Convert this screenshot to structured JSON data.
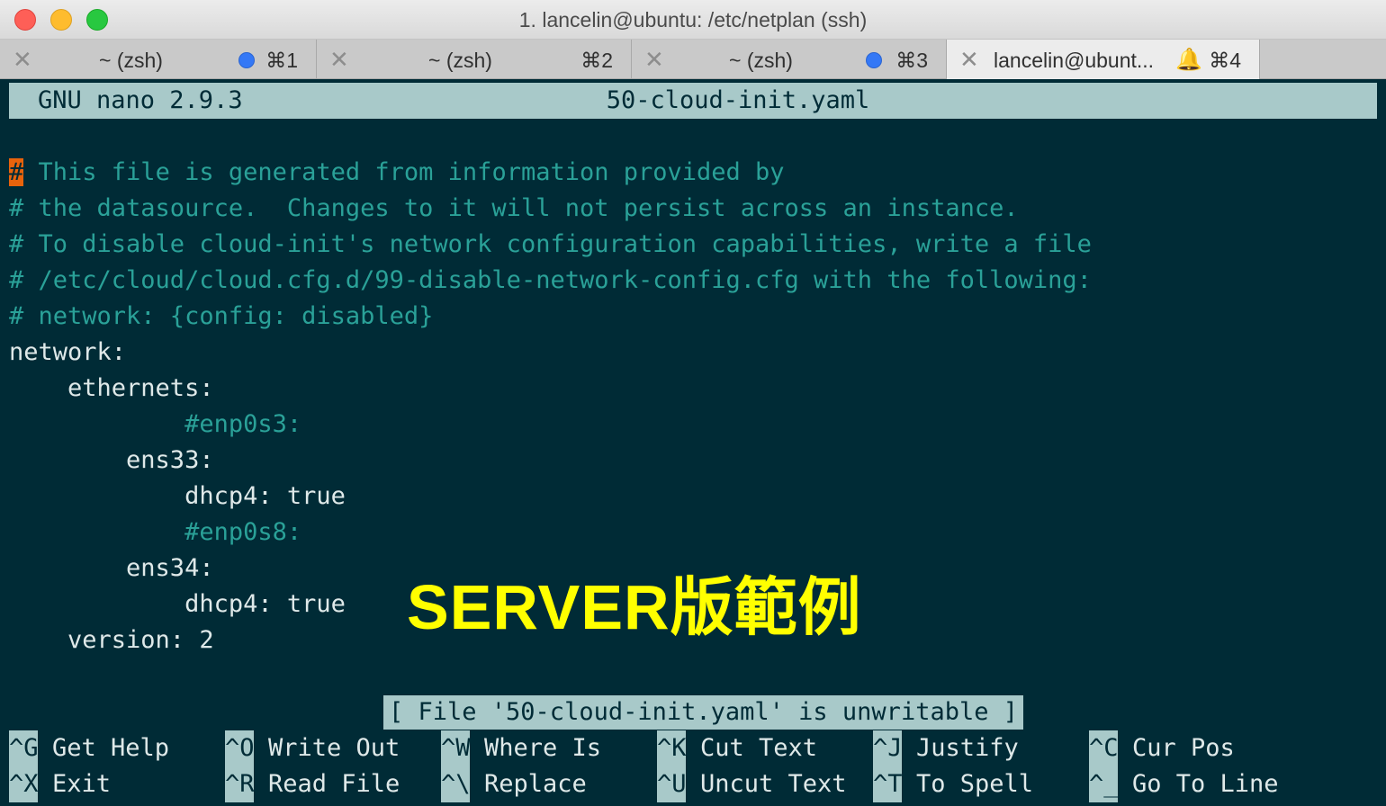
{
  "window": {
    "title": "1. lancelin@ubuntu: /etc/netplan (ssh)"
  },
  "tabs": [
    {
      "label": "~ (zsh)",
      "shortcut": "⌘1",
      "dot": true
    },
    {
      "label": "~ (zsh)",
      "shortcut": "⌘2",
      "dot": false
    },
    {
      "label": "~ (zsh)",
      "shortcut": "⌘3",
      "dot": true
    },
    {
      "label": "lancelin@ubunt...",
      "shortcut": "⌘4",
      "bell": true,
      "active": true
    }
  ],
  "nano": {
    "version": "GNU nano 2.9.3",
    "filename": "50-cloud-init.yaml",
    "lines": [
      {
        "text": "# This file is generated from information provided by",
        "type": "comment"
      },
      {
        "text": "# the datasource.  Changes to it will not persist across an instance.",
        "type": "comment"
      },
      {
        "text": "# To disable cloud-init's network configuration capabilities, write a file",
        "type": "comment"
      },
      {
        "text": "# /etc/cloud/cloud.cfg.d/99-disable-network-config.cfg with the following:",
        "type": "comment"
      },
      {
        "text": "# network: {config: disabled}",
        "type": "comment"
      },
      {
        "text": "network:",
        "type": "plain"
      },
      {
        "text": "    ethernets:",
        "type": "plain"
      },
      {
        "text": "            #enp0s3:",
        "type": "comment"
      },
      {
        "text": "        ens33:",
        "type": "plain"
      },
      {
        "text": "            dhcp4: true",
        "type": "plain"
      },
      {
        "text": "            #enp0s8:",
        "type": "comment"
      },
      {
        "text": "        ens34:",
        "type": "plain"
      },
      {
        "text": "            dhcp4: true",
        "type": "plain"
      },
      {
        "text": "    version: 2",
        "type": "plain"
      }
    ],
    "status": "[ File '50-cloud-init.yaml' is unwritable ]",
    "shortcuts": [
      [
        {
          "key": "^G",
          "label": "Get Help"
        },
        {
          "key": "^O",
          "label": "Write Out"
        },
        {
          "key": "^W",
          "label": "Where Is"
        },
        {
          "key": "^K",
          "label": "Cut Text"
        },
        {
          "key": "^J",
          "label": "Justify"
        },
        {
          "key": "^C",
          "label": "Cur Pos"
        }
      ],
      [
        {
          "key": "^X",
          "label": "Exit"
        },
        {
          "key": "^R",
          "label": "Read File"
        },
        {
          "key": "^\\",
          "label": "Replace"
        },
        {
          "key": "^U",
          "label": "Uncut Text"
        },
        {
          "key": "^T",
          "label": "To Spell"
        },
        {
          "key": "^_",
          "label": "Go To Line"
        }
      ]
    ]
  },
  "overlay": {
    "text": "SERVER版範例",
    "color": "#ffff00"
  }
}
